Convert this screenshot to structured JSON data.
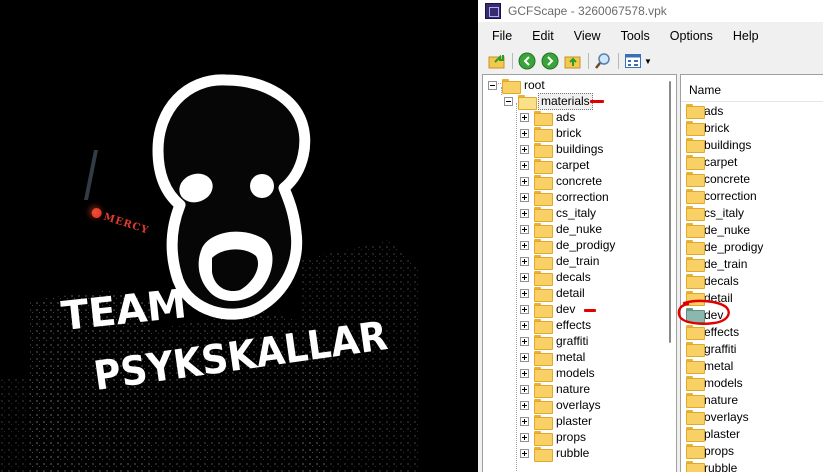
{
  "art": {
    "line1": "TEAM",
    "line2": "PSYKSKALLAR",
    "sign": "MERCY"
  },
  "window": {
    "title": "GCFScape - 3260067578.vpk",
    "menu": [
      "File",
      "Edit",
      "View",
      "Tools",
      "Options",
      "Help"
    ]
  },
  "toolbar": {
    "buttons": [
      "open-folder-icon",
      "back-icon",
      "forward-icon",
      "up-folder-icon",
      "search-icon",
      "view-icon"
    ]
  },
  "tree": {
    "root": "root",
    "materials": "materials",
    "children": [
      "ads",
      "brick",
      "buildings",
      "carpet",
      "concrete",
      "correction",
      "cs_italy",
      "de_nuke",
      "de_prodigy",
      "de_train",
      "decals",
      "detail",
      "dev",
      "effects",
      "graffiti",
      "metal",
      "models",
      "nature",
      "overlays",
      "plaster",
      "props",
      "rubble"
    ]
  },
  "list": {
    "header": "Name",
    "items": [
      "ads",
      "brick",
      "buildings",
      "carpet",
      "concrete",
      "correction",
      "cs_italy",
      "de_nuke",
      "de_prodigy",
      "de_train",
      "decals",
      "detail",
      "dev",
      "effects",
      "graffiti",
      "metal",
      "models",
      "nature",
      "overlays",
      "plaster",
      "props",
      "rubble"
    ]
  },
  "colors": {
    "annotation": "#e00000",
    "folder": "#f8d065",
    "dev_folder": "#8cb7ad"
  }
}
